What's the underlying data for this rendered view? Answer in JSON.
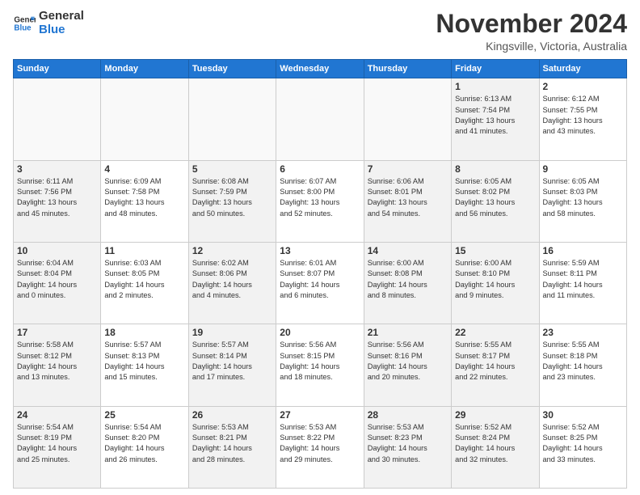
{
  "logo": {
    "line1": "General",
    "line2": "Blue"
  },
  "header": {
    "month": "November 2024",
    "location": "Kingsville, Victoria, Australia"
  },
  "days_of_week": [
    "Sunday",
    "Monday",
    "Tuesday",
    "Wednesday",
    "Thursday",
    "Friday",
    "Saturday"
  ],
  "weeks": [
    [
      {
        "day": "",
        "info": "",
        "empty": true
      },
      {
        "day": "",
        "info": "",
        "empty": true
      },
      {
        "day": "",
        "info": "",
        "empty": true
      },
      {
        "day": "",
        "info": "",
        "empty": true
      },
      {
        "day": "",
        "info": "",
        "empty": true
      },
      {
        "day": "1",
        "info": "Sunrise: 6:13 AM\nSunset: 7:54 PM\nDaylight: 13 hours\nand 41 minutes.",
        "shaded": true
      },
      {
        "day": "2",
        "info": "Sunrise: 6:12 AM\nSunset: 7:55 PM\nDaylight: 13 hours\nand 43 minutes."
      }
    ],
    [
      {
        "day": "3",
        "info": "Sunrise: 6:11 AM\nSunset: 7:56 PM\nDaylight: 13 hours\nand 45 minutes.",
        "shaded": true
      },
      {
        "day": "4",
        "info": "Sunrise: 6:09 AM\nSunset: 7:58 PM\nDaylight: 13 hours\nand 48 minutes."
      },
      {
        "day": "5",
        "info": "Sunrise: 6:08 AM\nSunset: 7:59 PM\nDaylight: 13 hours\nand 50 minutes.",
        "shaded": true
      },
      {
        "day": "6",
        "info": "Sunrise: 6:07 AM\nSunset: 8:00 PM\nDaylight: 13 hours\nand 52 minutes."
      },
      {
        "day": "7",
        "info": "Sunrise: 6:06 AM\nSunset: 8:01 PM\nDaylight: 13 hours\nand 54 minutes.",
        "shaded": true
      },
      {
        "day": "8",
        "info": "Sunrise: 6:05 AM\nSunset: 8:02 PM\nDaylight: 13 hours\nand 56 minutes.",
        "shaded": true
      },
      {
        "day": "9",
        "info": "Sunrise: 6:05 AM\nSunset: 8:03 PM\nDaylight: 13 hours\nand 58 minutes."
      }
    ],
    [
      {
        "day": "10",
        "info": "Sunrise: 6:04 AM\nSunset: 8:04 PM\nDaylight: 14 hours\nand 0 minutes.",
        "shaded": true
      },
      {
        "day": "11",
        "info": "Sunrise: 6:03 AM\nSunset: 8:05 PM\nDaylight: 14 hours\nand 2 minutes."
      },
      {
        "day": "12",
        "info": "Sunrise: 6:02 AM\nSunset: 8:06 PM\nDaylight: 14 hours\nand 4 minutes.",
        "shaded": true
      },
      {
        "day": "13",
        "info": "Sunrise: 6:01 AM\nSunset: 8:07 PM\nDaylight: 14 hours\nand 6 minutes."
      },
      {
        "day": "14",
        "info": "Sunrise: 6:00 AM\nSunset: 8:08 PM\nDaylight: 14 hours\nand 8 minutes.",
        "shaded": true
      },
      {
        "day": "15",
        "info": "Sunrise: 6:00 AM\nSunset: 8:10 PM\nDaylight: 14 hours\nand 9 minutes.",
        "shaded": true
      },
      {
        "day": "16",
        "info": "Sunrise: 5:59 AM\nSunset: 8:11 PM\nDaylight: 14 hours\nand 11 minutes."
      }
    ],
    [
      {
        "day": "17",
        "info": "Sunrise: 5:58 AM\nSunset: 8:12 PM\nDaylight: 14 hours\nand 13 minutes.",
        "shaded": true
      },
      {
        "day": "18",
        "info": "Sunrise: 5:57 AM\nSunset: 8:13 PM\nDaylight: 14 hours\nand 15 minutes."
      },
      {
        "day": "19",
        "info": "Sunrise: 5:57 AM\nSunset: 8:14 PM\nDaylight: 14 hours\nand 17 minutes.",
        "shaded": true
      },
      {
        "day": "20",
        "info": "Sunrise: 5:56 AM\nSunset: 8:15 PM\nDaylight: 14 hours\nand 18 minutes."
      },
      {
        "day": "21",
        "info": "Sunrise: 5:56 AM\nSunset: 8:16 PM\nDaylight: 14 hours\nand 20 minutes.",
        "shaded": true
      },
      {
        "day": "22",
        "info": "Sunrise: 5:55 AM\nSunset: 8:17 PM\nDaylight: 14 hours\nand 22 minutes.",
        "shaded": true
      },
      {
        "day": "23",
        "info": "Sunrise: 5:55 AM\nSunset: 8:18 PM\nDaylight: 14 hours\nand 23 minutes."
      }
    ],
    [
      {
        "day": "24",
        "info": "Sunrise: 5:54 AM\nSunset: 8:19 PM\nDaylight: 14 hours\nand 25 minutes.",
        "shaded": true
      },
      {
        "day": "25",
        "info": "Sunrise: 5:54 AM\nSunset: 8:20 PM\nDaylight: 14 hours\nand 26 minutes."
      },
      {
        "day": "26",
        "info": "Sunrise: 5:53 AM\nSunset: 8:21 PM\nDaylight: 14 hours\nand 28 minutes.",
        "shaded": true
      },
      {
        "day": "27",
        "info": "Sunrise: 5:53 AM\nSunset: 8:22 PM\nDaylight: 14 hours\nand 29 minutes."
      },
      {
        "day": "28",
        "info": "Sunrise: 5:53 AM\nSunset: 8:23 PM\nDaylight: 14 hours\nand 30 minutes.",
        "shaded": true
      },
      {
        "day": "29",
        "info": "Sunrise: 5:52 AM\nSunset: 8:24 PM\nDaylight: 14 hours\nand 32 minutes.",
        "shaded": true
      },
      {
        "day": "30",
        "info": "Sunrise: 5:52 AM\nSunset: 8:25 PM\nDaylight: 14 hours\nand 33 minutes."
      }
    ]
  ]
}
